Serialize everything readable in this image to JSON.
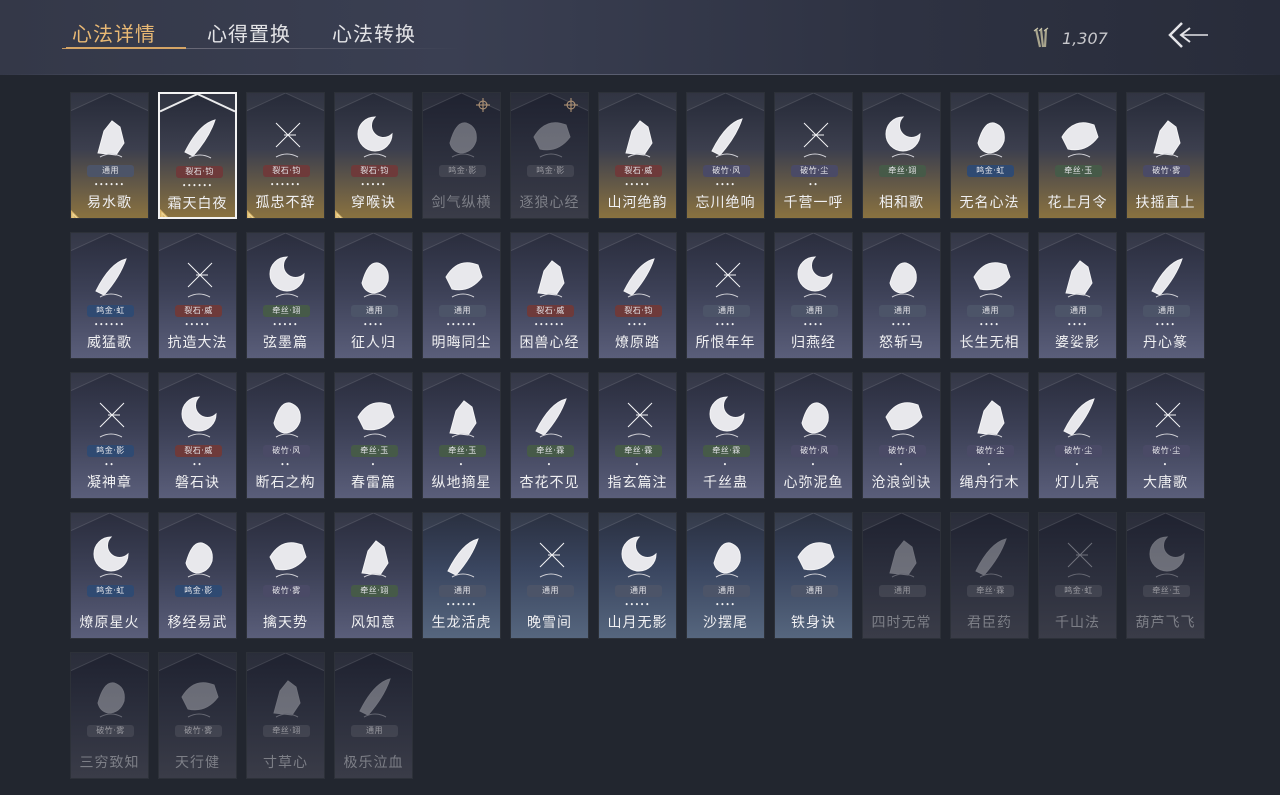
{
  "header": {
    "tabs": [
      {
        "label": "心法详情",
        "active": true
      },
      {
        "label": "心得置换",
        "active": false
      },
      {
        "label": "心法转换",
        "active": false
      }
    ],
    "currency": {
      "icon": "arrows-currency-icon",
      "value": "1,307"
    },
    "back_icon": "back-arrow-icon"
  },
  "colors": {
    "tab_active": "#e8b874",
    "tag_tongyong": "#4c5468",
    "tag_liesh": "#6e3a3a",
    "tag_mingjin": "#2f4a72",
    "tag_podzhu": "#4a4a66",
    "tag_raosi": "#465a48",
    "card_gold": "#8a7240",
    "card_blue": "#3b3f56"
  },
  "cards": [
    {
      "name": "易水歌",
      "tag": "通用",
      "stars": "••••••",
      "style": "gold",
      "icon": "horse-icon",
      "corner": true
    },
    {
      "name": "霜天白夜",
      "tag": "裂石·钧",
      "stars": "••••••",
      "style": "gold",
      "icon": "sword-icon",
      "selected": true,
      "corner": true
    },
    {
      "name": "孤忠不辞",
      "tag": "裂石·钧",
      "stars": "••••••",
      "style": "gold",
      "icon": "crossed-blades-icon",
      "corner": true
    },
    {
      "name": "穿喉诀",
      "tag": "裂石·钧",
      "stars": "•••••",
      "style": "gold",
      "icon": "moon-bird-icon",
      "corner": true
    },
    {
      "name": "剑气纵横",
      "tag": "鸣金·影",
      "stars": "",
      "style": "dark",
      "icon": "sword-whirl-icon",
      "locked": true,
      "crosshair": true
    },
    {
      "name": "逐狼心经",
      "tag": "鸣金·影",
      "stars": "",
      "style": "dark",
      "icon": "wolf-icon",
      "locked": true,
      "crosshair": true
    },
    {
      "name": "山河绝韵",
      "tag": "裂石·威",
      "stars": "•••••",
      "style": "gold",
      "icon": "mountain-icon"
    },
    {
      "name": "忘川绝响",
      "tag": "破竹·风",
      "stars": "••••",
      "style": "gold",
      "icon": "mask-icon"
    },
    {
      "name": "千营一呼",
      "tag": "破竹·尘",
      "stars": "••",
      "style": "gold",
      "icon": "flag-icon"
    },
    {
      "name": "相和歌",
      "tag": "牵丝·翊",
      "stars": "",
      "style": "gold",
      "icon": "lion-icon"
    },
    {
      "name": "无名心法",
      "tag": "鸣金·虹",
      "stars": "",
      "style": "gold",
      "icon": "blade-icon"
    },
    {
      "name": "花上月令",
      "tag": "牵丝·玉",
      "stars": "",
      "style": "gold",
      "icon": "moon-flower-icon"
    },
    {
      "name": "扶摇直上",
      "tag": "破竹·雾",
      "stars": "",
      "style": "gold",
      "icon": "eagle-icon"
    },
    {
      "name": "威猛歌",
      "tag": "鸣金·虹",
      "stars": "••••••",
      "style": "blue",
      "icon": "fist-icon"
    },
    {
      "name": "抗造大法",
      "tag": "裂石·威",
      "stars": "•••••",
      "style": "blue",
      "icon": "bell-icon"
    },
    {
      "name": "弦墨篇",
      "tag": "牵丝·翊",
      "stars": "•••••",
      "style": "blue",
      "icon": "zither-icon"
    },
    {
      "name": "征人归",
      "tag": "通用",
      "stars": "••••",
      "style": "blue",
      "icon": "hawk-icon"
    },
    {
      "name": "明晦同尘",
      "tag": "通用",
      "stars": "••••••",
      "style": "blue",
      "icon": "snake-icon"
    },
    {
      "name": "困兽心经",
      "tag": "裂石·威",
      "stars": "••••••",
      "style": "blue",
      "icon": "drum-icon"
    },
    {
      "name": "燎原踏",
      "tag": "裂石·钧",
      "stars": "••••",
      "style": "blue",
      "icon": "stallion-icon"
    },
    {
      "name": "所恨年年",
      "tag": "通用",
      "stars": "••••",
      "style": "blue",
      "icon": "reed-icon"
    },
    {
      "name": "归燕经",
      "tag": "通用",
      "stars": "••••",
      "style": "blue",
      "icon": "swallow-icon"
    },
    {
      "name": "怒斩马",
      "tag": "通用",
      "stars": "••••",
      "style": "blue",
      "icon": "glaive-icon"
    },
    {
      "name": "长生无相",
      "tag": "通用",
      "stars": "••••",
      "style": "blue",
      "icon": "statue-icon"
    },
    {
      "name": "婆娑影",
      "tag": "通用",
      "stars": "••••",
      "style": "blue",
      "icon": "dragon-icon"
    },
    {
      "name": "丹心篆",
      "tag": "通用",
      "stars": "••••",
      "style": "blue",
      "icon": "scroll-icon"
    },
    {
      "name": "凝神章",
      "tag": "鸣金·影",
      "stars": "••",
      "style": "blue",
      "icon": "bow-icon"
    },
    {
      "name": "磐石诀",
      "tag": "裂石·威",
      "stars": "••",
      "style": "blue",
      "icon": "rock-icon"
    },
    {
      "name": "断石之构",
      "tag": "破竹·风",
      "stars": "••",
      "style": "blue",
      "icon": "warrior-icon"
    },
    {
      "name": "春雷篇",
      "tag": "牵丝·玉",
      "stars": "•",
      "style": "blue",
      "icon": "tree-icon"
    },
    {
      "name": "纵地摘星",
      "tag": "牵丝·玉",
      "stars": "•",
      "style": "blue",
      "icon": "leap-icon"
    },
    {
      "name": "杏花不见",
      "tag": "牵丝·霖",
      "stars": "•",
      "style": "blue",
      "icon": "blossom-icon"
    },
    {
      "name": "指玄篇注",
      "tag": "牵丝·霖",
      "stars": "•",
      "style": "blue",
      "icon": "yinyang-icon"
    },
    {
      "name": "千丝蛊",
      "tag": "牵丝·霖",
      "stars": "•",
      "style": "blue",
      "icon": "leaf-icon"
    },
    {
      "name": "心弥泥鱼",
      "tag": "破竹·风",
      "stars": "•",
      "style": "blue",
      "icon": "fish-icon"
    },
    {
      "name": "沧浪剑诀",
      "tag": "破竹·风",
      "stars": "•",
      "style": "blue",
      "icon": "coil-dragon-icon"
    },
    {
      "name": "绳舟行木",
      "tag": "破竹·尘",
      "stars": "•",
      "style": "blue",
      "icon": "vine-icon"
    },
    {
      "name": "灯儿亮",
      "tag": "破竹·尘",
      "stars": "•",
      "style": "blue",
      "icon": "lamp-icon"
    },
    {
      "name": "大唐歌",
      "tag": "破竹·尘",
      "stars": "•",
      "style": "blue",
      "icon": "palace-icon"
    },
    {
      "name": "燎原星火",
      "tag": "鸣金·虹",
      "stars": "",
      "style": "blue",
      "icon": "scythe-icon"
    },
    {
      "name": "移经易武",
      "tag": "鸣金·影",
      "stars": "",
      "style": "blue",
      "icon": "armor-icon"
    },
    {
      "name": "擒天势",
      "tag": "破竹·雾",
      "stars": "",
      "style": "blue",
      "icon": "chain-icon"
    },
    {
      "name": "风知意",
      "tag": "牵丝·翊",
      "stars": "",
      "style": "blue",
      "icon": "fan-icon"
    },
    {
      "name": "生龙活虎",
      "tag": "通用",
      "stars": "••••••",
      "style": "teal",
      "icon": "kick-icon"
    },
    {
      "name": "晚雪间",
      "tag": "通用",
      "stars": "",
      "style": "teal",
      "icon": "cross-icon"
    },
    {
      "name": "山月无影",
      "tag": "通用",
      "stars": "•••••",
      "style": "teal",
      "icon": "slash-icon"
    },
    {
      "name": "沙摆尾",
      "tag": "通用",
      "stars": "••••",
      "style": "teal",
      "icon": "wave-icon"
    },
    {
      "name": "铁身诀",
      "tag": "通用",
      "stars": "",
      "style": "teal",
      "icon": "muscle-icon"
    },
    {
      "name": "四时无常",
      "tag": "通用",
      "stars": "",
      "style": "dark",
      "icon": "hidden-figure-icon",
      "locked": true
    },
    {
      "name": "君臣药",
      "tag": "牵丝·霖",
      "stars": "",
      "style": "dark",
      "icon": "herb-icon",
      "locked": true
    },
    {
      "name": "千山法",
      "tag": "鸣金·虹",
      "stars": "",
      "style": "dark",
      "icon": "hat-figure-icon",
      "locked": true
    },
    {
      "name": "葫芦飞飞",
      "tag": "牵丝·玉",
      "stars": "",
      "style": "dark",
      "icon": "gourd-icon",
      "locked": true
    },
    {
      "name": "三穷致知",
      "tag": "破竹·雾",
      "stars": "",
      "style": "dark",
      "icon": "book-icon",
      "locked": true
    },
    {
      "name": "天行健",
      "tag": "破竹·雾",
      "stars": "",
      "style": "dark",
      "icon": "straw-hat-icon",
      "locked": true
    },
    {
      "name": "寸草心",
      "tag": "牵丝·翊",
      "stars": "",
      "style": "dark",
      "icon": "grass-icon",
      "locked": true
    },
    {
      "name": "极乐泣血",
      "tag": "通用",
      "stars": "",
      "style": "dark",
      "icon": "blood-icon",
      "locked": true
    }
  ]
}
